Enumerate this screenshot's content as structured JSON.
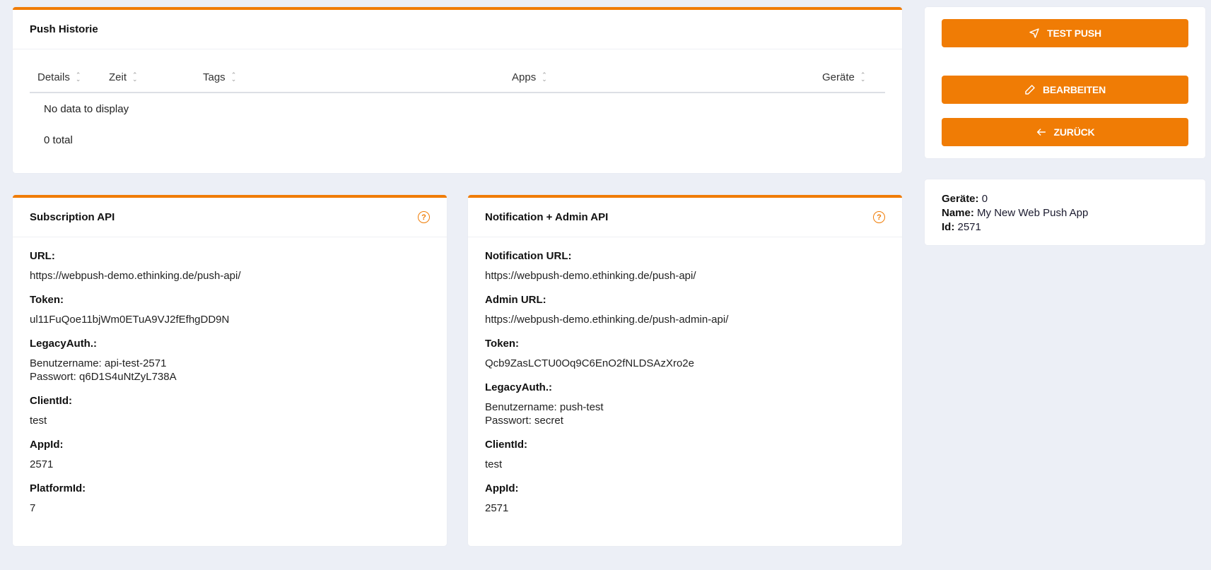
{
  "history": {
    "title": "Push Historie",
    "columns": [
      {
        "label": "Details"
      },
      {
        "label": "Zeit"
      },
      {
        "label": "Tags"
      },
      {
        "label": "Apps"
      },
      {
        "label": "Geräte"
      }
    ],
    "empty_text": "No data to display",
    "total_text": "0 total"
  },
  "subscription_api": {
    "title": "Subscription API",
    "fields": [
      {
        "label": "URL:",
        "value": "https://webpush-demo.ethinking.de/push-api/"
      },
      {
        "label": "Token:",
        "value": "ul11FuQoe11bjWm0ETuA9VJ2fEfhgDD9N"
      },
      {
        "label": "LegacyAuth.:",
        "lines": [
          "Benutzername: api-test-2571",
          "Passwort: q6D1S4uNtZyL738A"
        ]
      },
      {
        "label": "ClientId:",
        "value": "test"
      },
      {
        "label": "AppId:",
        "value": "2571"
      },
      {
        "label": "PlatformId:",
        "value": "7"
      }
    ]
  },
  "notification_api": {
    "title": "Notification + Admin API",
    "fields": [
      {
        "label": "Notification URL:",
        "value": "https://webpush-demo.ethinking.de/push-api/"
      },
      {
        "label": "Admin URL:",
        "value": "https://webpush-demo.ethinking.de/push-admin-api/"
      },
      {
        "label": "Token:",
        "value": "Qcb9ZasLCTU0Oq9C6EnO2fNLDSAzXro2e"
      },
      {
        "label": "LegacyAuth.:",
        "lines": [
          "Benutzername: push-test",
          "Passwort: secret"
        ]
      },
      {
        "label": "ClientId:",
        "value": "test"
      },
      {
        "label": "AppId:",
        "value": "2571"
      }
    ]
  },
  "actions": {
    "test_push": "TEST PUSH",
    "edit": "BEARBEITEN",
    "back": "ZURÜCK"
  },
  "info": {
    "devices_label": "Geräte:",
    "devices_value": "0",
    "name_label": "Name:",
    "name_value": "My New Web Push App",
    "id_label": "Id:",
    "id_value": "2571"
  },
  "colors": {
    "accent": "#F07C05",
    "background": "#ECEFF6"
  }
}
